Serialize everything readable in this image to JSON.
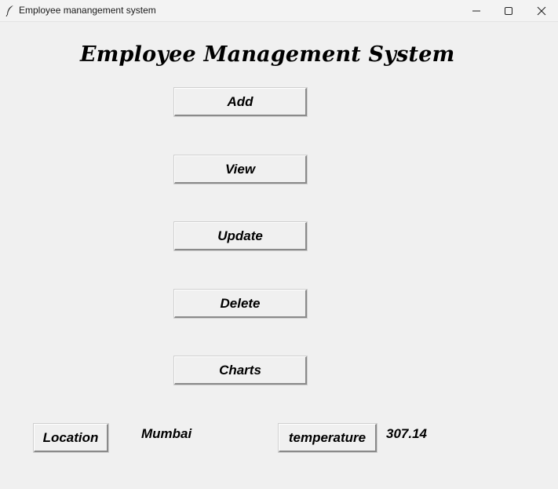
{
  "window": {
    "title": "Employee manangement system"
  },
  "main": {
    "heading": "Employee Management System",
    "menu_buttons": [
      {
        "label": "Add"
      },
      {
        "label": "View"
      },
      {
        "label": "Update"
      },
      {
        "label": "Delete"
      },
      {
        "label": "Charts"
      }
    ]
  },
  "footer": {
    "location_button": "Location",
    "location_value": "Mumbai",
    "temperature_button": "temperature",
    "temperature_value": "307.14"
  },
  "icons": {
    "app": "feather-icon",
    "minimize": "minimize-icon",
    "maximize": "maximize-icon",
    "close": "close-icon"
  }
}
